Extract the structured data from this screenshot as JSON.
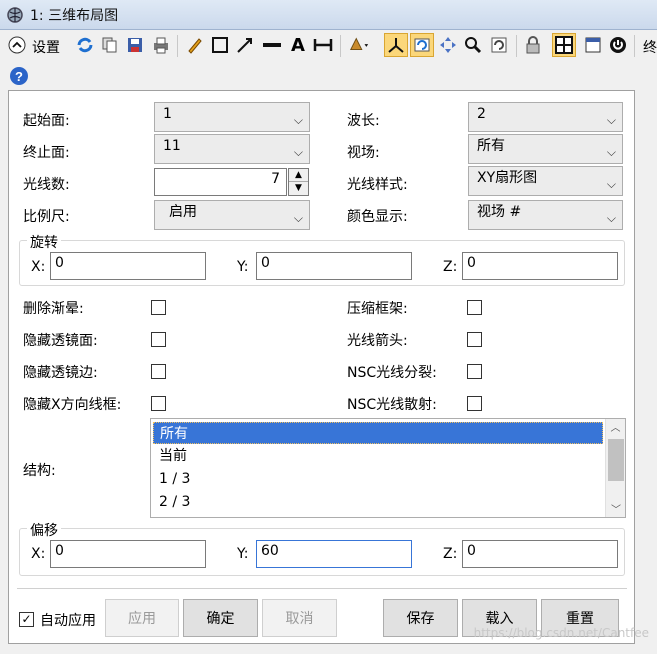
{
  "window": {
    "title": "1: 三维布局图"
  },
  "toolbar": {
    "settings_label": "设置",
    "overflow_label": "终",
    "icons": [
      "collapse-icon",
      "refresh-icon",
      "copy-icon",
      "save-icon",
      "print-icon",
      "pencil-icon",
      "rectangle-icon",
      "arrow-line-icon",
      "line-icon",
      "text-icon",
      "dimension-icon",
      "rotate-axes-icon",
      "axes-icon",
      "layout-rotate-icon",
      "pan-icon",
      "zoom-icon",
      "reset-icon",
      "lock-icon",
      "grid-icon",
      "window-icon",
      "power-icon",
      "help-icon"
    ]
  },
  "form": {
    "start_surface": {
      "label": "起始面:",
      "value": "1"
    },
    "stop_surface": {
      "label": "终止面:",
      "value": "11"
    },
    "num_rays": {
      "label": "光线数:",
      "value": "7"
    },
    "scale": {
      "label": "比例尺:",
      "value": "启用"
    },
    "wavelength": {
      "label": "波长:",
      "value": "2"
    },
    "field": {
      "label": "视场:",
      "value": "所有"
    },
    "ray_pattern": {
      "label": "光线样式:",
      "value": "XY扇形图"
    },
    "color_by": {
      "label": "颜色显示:",
      "value": "视场 #"
    }
  },
  "rotation": {
    "title": "旋转",
    "x_label": "X:",
    "x_value": "0",
    "y_label": "Y:",
    "y_value": "0",
    "z_label": "Z:",
    "z_value": "0"
  },
  "checks": {
    "delete_vignetted": "删除渐晕:",
    "hide_lens_faces": "隐藏透镜面:",
    "hide_lens_edges": "隐藏透镜边:",
    "hide_x_bars": "隐藏X方向线框:",
    "suppress_frame": "压缩框架:",
    "ray_arrows": "光线箭头:",
    "nsc_split": "NSC光线分裂:",
    "nsc_scatter": "NSC光线散射:"
  },
  "config": {
    "label": "结构:",
    "items": [
      "所有",
      "当前",
      "1 / 3",
      "2 / 3"
    ],
    "selected": "所有"
  },
  "offset": {
    "title": "偏移",
    "x_label": "X:",
    "x_value": "0",
    "y_label": "Y:",
    "y_value": "60",
    "z_label": "Z:",
    "z_value": "0"
  },
  "footer": {
    "auto_apply_label": "自动应用",
    "auto_apply_checked": true,
    "apply": "应用",
    "ok": "确定",
    "cancel": "取消",
    "save": "保存",
    "load": "载入",
    "reset": "重置"
  },
  "watermark": "https://blog.csdn.net/Cantfee"
}
